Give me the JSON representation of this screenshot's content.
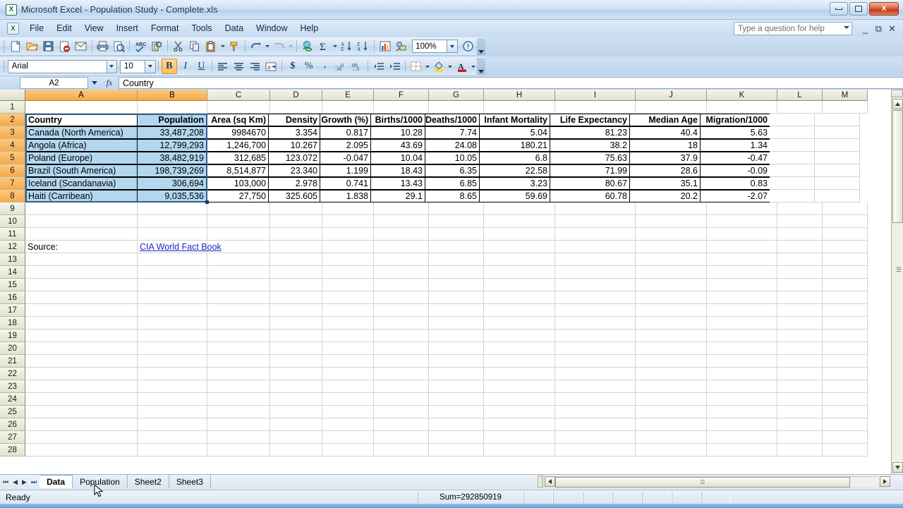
{
  "window": {
    "title": "Microsoft Excel - Population Study - Complete.xls",
    "app_icon": "excel-icon",
    "minimize_label": "Minimize",
    "restore_label": "Restore",
    "close_label": "X"
  },
  "menu": {
    "items": [
      "File",
      "Edit",
      "View",
      "Insert",
      "Format",
      "Tools",
      "Data",
      "Window",
      "Help"
    ],
    "help_box_placeholder": "Type a question for help"
  },
  "standard_toolbar": {
    "zoom_value": "100%",
    "buttons": [
      "new-icon",
      "open-icon",
      "save-icon",
      "permission-icon",
      "email-icon",
      "print-icon",
      "print-preview-icon",
      "spelling-icon",
      "research-icon",
      "cut-icon",
      "copy-icon",
      "paste-icon",
      "format-painter-icon",
      "undo-icon",
      "redo-icon",
      "hyperlink-icon",
      "autosum-icon",
      "sort-ascending-icon",
      "sort-descending-icon",
      "chart-wizard-icon",
      "drawing-icon",
      "help-icon"
    ]
  },
  "formatting_toolbar": {
    "font_name": "Arial",
    "font_size": "10",
    "bold_label": "B",
    "italic_label": "I",
    "underline_label": "U",
    "currency_label": "$",
    "percent_label": "%",
    "comma_label": ",",
    "bold_active": true
  },
  "formula_bar": {
    "name_box": "A2",
    "fx_label": "fx",
    "formula_value": "Country"
  },
  "grid": {
    "column_headers": [
      "A",
      "B",
      "C",
      "D",
      "E",
      "F",
      "G",
      "H",
      "I",
      "J",
      "K",
      "L",
      "M"
    ],
    "selected_columns": [
      "A",
      "B"
    ],
    "row_numbers": [
      1,
      2,
      3,
      4,
      5,
      6,
      7,
      8,
      9,
      10,
      11,
      12,
      13,
      14,
      15,
      16,
      17,
      18,
      19,
      20,
      21,
      22,
      23,
      24,
      25,
      26,
      27,
      28
    ],
    "selected_rows": [
      2,
      3,
      4,
      5,
      6,
      7,
      8
    ],
    "table_headers": [
      "Country",
      "Population",
      "Area (sq Km)",
      "Density",
      "Growth (%)",
      "Births/1000",
      "Deaths/1000",
      "Infant Mortality",
      "Life Expectancy",
      "Median Age",
      "Migration/1000"
    ],
    "table_rows": [
      {
        "row": 3,
        "cells": [
          "Canada (North America)",
          "33,487,208",
          "9984670",
          "3.354",
          "0.817",
          "10.28",
          "7.74",
          "5.04",
          "81.23",
          "40.4",
          "5.63"
        ]
      },
      {
        "row": 4,
        "cells": [
          "Angola (Africa)",
          "12,799,293",
          "1,246,700",
          "10.267",
          "2.095",
          "43.69",
          "24.08",
          "180.21",
          "38.2",
          "18",
          "1.34"
        ]
      },
      {
        "row": 5,
        "cells": [
          "Poland (Europe)",
          "38,482,919",
          "312,685",
          "123.072",
          "-0.047",
          "10.04",
          "10.05",
          "6.8",
          "75.63",
          "37.9",
          "-0.47"
        ]
      },
      {
        "row": 6,
        "cells": [
          "Brazil (South America)",
          "198,739,269",
          "8,514,877",
          "23.340",
          "1.199",
          "18.43",
          "6.35",
          "22.58",
          "71.99",
          "28.6",
          "-0.09"
        ]
      },
      {
        "row": 7,
        "cells": [
          "Iceland (Scandanavia)",
          "306,694",
          "103,000",
          "2.978",
          "0.741",
          "13.43",
          "6.85",
          "3.23",
          "80.67",
          "35.1",
          "0.83"
        ]
      },
      {
        "row": 8,
        "cells": [
          "Haiti (Carribean)",
          "9,035,536",
          "27,750",
          "325.605",
          "1.838",
          "29.1",
          "8.65",
          "59.69",
          "60.78",
          "20.2",
          "-2.07"
        ]
      }
    ],
    "source_row": {
      "row": 12,
      "label": "Source:",
      "link_text": "CIA World Fact Book"
    }
  },
  "sheet_tabs": {
    "tabs": [
      "Data",
      "Population",
      "Sheet2",
      "Sheet3"
    ],
    "active": "Data"
  },
  "status_bar": {
    "message": "Ready",
    "sum_text": "Sum=292850919"
  },
  "chart_data": {
    "type": "table",
    "title": "Population Study",
    "columns": [
      "Country",
      "Population",
      "Area (sq Km)",
      "Density",
      "Growth (%)",
      "Births/1000",
      "Deaths/1000",
      "Infant Mortality",
      "Life Expectancy",
      "Median Age",
      "Migration/1000"
    ],
    "rows": [
      [
        "Canada (North America)",
        33487208,
        9984670,
        3.354,
        0.817,
        10.28,
        7.74,
        5.04,
        81.23,
        40.4,
        5.63
      ],
      [
        "Angola (Africa)",
        12799293,
        1246700,
        10.267,
        2.095,
        43.69,
        24.08,
        180.21,
        38.2,
        18,
        1.34
      ],
      [
        "Poland (Europe)",
        38482919,
        312685,
        123.072,
        -0.047,
        10.04,
        10.05,
        6.8,
        75.63,
        37.9,
        -0.47
      ],
      [
        "Brazil (South America)",
        198739269,
        8514877,
        23.34,
        1.199,
        18.43,
        6.35,
        22.58,
        71.99,
        28.6,
        -0.09
      ],
      [
        "Iceland (Scandanavia)",
        306694,
        103000,
        2.978,
        0.741,
        13.43,
        6.85,
        3.23,
        80.67,
        35.1,
        0.83
      ],
      [
        "Haiti (Carribean)",
        9035536,
        27750,
        325.605,
        1.838,
        29.1,
        8.65,
        59.69,
        60.78,
        20.2,
        -2.07
      ]
    ],
    "population_sum": 292850919,
    "source": "CIA World Fact Book"
  }
}
